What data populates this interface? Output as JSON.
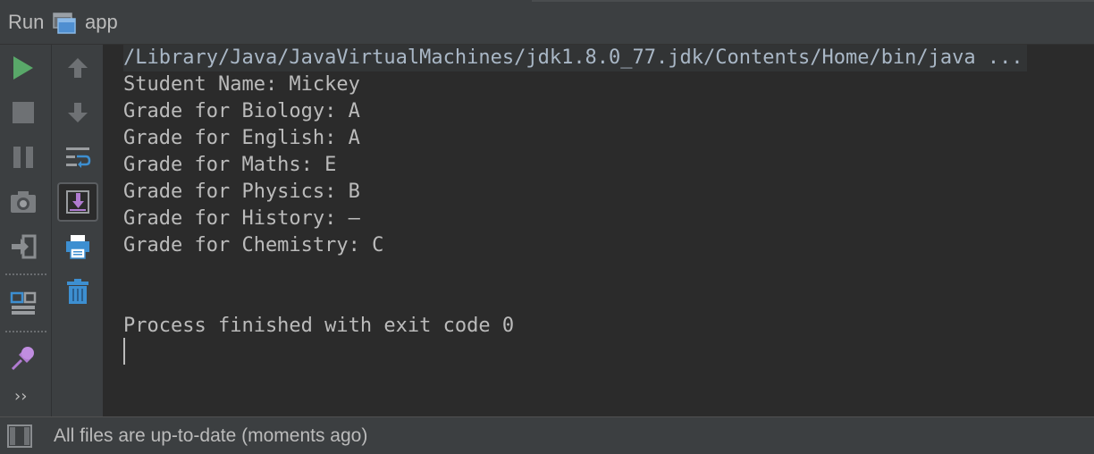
{
  "window": {
    "run_label": "Run",
    "config_icon": "app-window-icon",
    "config_name": "app"
  },
  "toolbar_left": {
    "buttons": [
      {
        "name": "rerun",
        "icon": "play-icon"
      },
      {
        "name": "stop",
        "icon": "stop-icon"
      },
      {
        "name": "pause",
        "icon": "pause-icon"
      },
      {
        "name": "dump-threads",
        "icon": "camera-icon"
      },
      {
        "name": "exit",
        "icon": "exit-icon"
      },
      {
        "name": "layout",
        "icon": "layout-icon"
      },
      {
        "name": "pin",
        "icon": "pin-icon"
      },
      {
        "name": "more",
        "icon": "more-chevron",
        "label": "››"
      }
    ]
  },
  "toolbar_right": {
    "buttons": [
      {
        "name": "up",
        "icon": "arrow-up-icon"
      },
      {
        "name": "down",
        "icon": "arrow-down-icon"
      },
      {
        "name": "soft-wraps",
        "icon": "soft-wrap-icon"
      },
      {
        "name": "scroll-to-end",
        "icon": "scroll-to-end-icon",
        "toggled": true
      },
      {
        "name": "print",
        "icon": "print-icon"
      },
      {
        "name": "clear-all",
        "icon": "trash-icon"
      }
    ]
  },
  "console": {
    "command": "/Library/Java/JavaVirtualMachines/jdk1.8.0_77.jdk/Contents/Home/bin/java ...",
    "output": [
      "Student Name: Mickey",
      "Grade for Biology: A",
      "Grade for English: A",
      "Grade for Maths: E",
      "Grade for Physics: B",
      "Grade for History: –",
      "Grade for Chemistry: C"
    ],
    "exit_message": "Process finished with exit code 0"
  },
  "status": {
    "text": "All files are up-to-date (moments ago)",
    "icon": "tool-window-icon"
  },
  "colors": {
    "panel": "#3c3f41",
    "console_bg": "#2b2b2b",
    "text": "#bbbbbb",
    "run_green": "#59a869",
    "accent_blue": "#3d8fd1",
    "accent_purple": "#b07bd1"
  }
}
